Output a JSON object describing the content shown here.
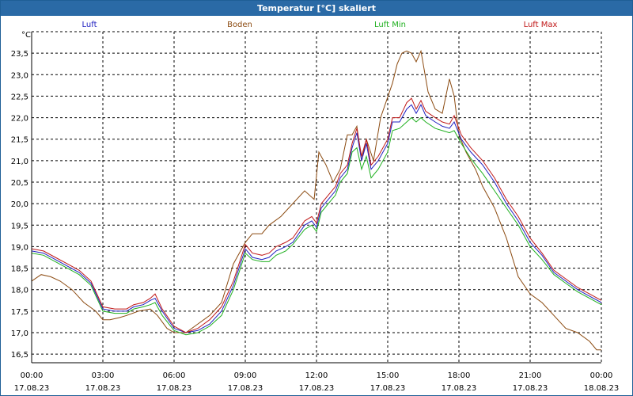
{
  "window": {
    "title": "Temperatur [°C] skaliert"
  },
  "chart_data": {
    "type": "line",
    "title": "Temperatur [°C] skaliert",
    "ylabel": "°C",
    "ylim": [
      16.3,
      24.0
    ],
    "yticks": [
      "16,5",
      "17,0",
      "17,5",
      "18,0",
      "18,5",
      "19,0",
      "19,5",
      "20,0",
      "20,5",
      "21,0",
      "21,5",
      "22,0",
      "22,5",
      "23,0",
      "23,5"
    ],
    "xlim_hours": [
      0,
      24
    ],
    "xticks": [
      {
        "time": "00:00",
        "date": "17.08.23"
      },
      {
        "time": "03:00",
        "date": "17.08.23"
      },
      {
        "time": "06:00",
        "date": "17.08.23"
      },
      {
        "time": "09:00",
        "date": "17.08.23"
      },
      {
        "time": "12:00",
        "date": "17.08.23"
      },
      {
        "time": "15:00",
        "date": "17.08.23"
      },
      {
        "time": "18:00",
        "date": "17.08.23"
      },
      {
        "time": "21:00",
        "date": "17.08.23"
      },
      {
        "time": "00:00",
        "date": "18.08.23"
      }
    ],
    "grid": true,
    "legend_position": "top",
    "series": [
      {
        "name": "Luft",
        "color": "#2020c0",
        "points": [
          [
            0,
            18.9
          ],
          [
            0.5,
            18.85
          ],
          [
            1,
            18.7
          ],
          [
            1.5,
            18.55
          ],
          [
            2,
            18.4
          ],
          [
            2.5,
            18.15
          ],
          [
            3,
            17.55
          ],
          [
            3.5,
            17.5
          ],
          [
            4,
            17.5
          ],
          [
            4.3,
            17.6
          ],
          [
            4.7,
            17.65
          ],
          [
            5,
            17.75
          ],
          [
            5.2,
            17.8
          ],
          [
            5.5,
            17.5
          ],
          [
            6,
            17.1
          ],
          [
            6.5,
            17.0
          ],
          [
            7,
            17.05
          ],
          [
            7.5,
            17.2
          ],
          [
            8,
            17.5
          ],
          [
            8.5,
            18.1
          ],
          [
            9,
            18.95
          ],
          [
            9.3,
            18.75
          ],
          [
            9.7,
            18.7
          ],
          [
            10,
            18.75
          ],
          [
            10.3,
            18.9
          ],
          [
            10.7,
            19.0
          ],
          [
            11,
            19.1
          ],
          [
            11.5,
            19.5
          ],
          [
            11.8,
            19.6
          ],
          [
            12,
            19.45
          ],
          [
            12.2,
            19.9
          ],
          [
            12.5,
            20.1
          ],
          [
            12.8,
            20.3
          ],
          [
            13,
            20.6
          ],
          [
            13.3,
            20.8
          ],
          [
            13.5,
            21.3
          ],
          [
            13.7,
            21.65
          ],
          [
            13.9,
            21.0
          ],
          [
            14.1,
            21.4
          ],
          [
            14.3,
            20.8
          ],
          [
            14.6,
            21.0
          ],
          [
            15,
            21.4
          ],
          [
            15.2,
            21.9
          ],
          [
            15.5,
            21.9
          ],
          [
            15.8,
            22.2
          ],
          [
            16,
            22.3
          ],
          [
            16.2,
            22.1
          ],
          [
            16.4,
            22.3
          ],
          [
            16.6,
            22.05
          ],
          [
            17,
            21.9
          ],
          [
            17.3,
            21.8
          ],
          [
            17.6,
            21.75
          ],
          [
            17.8,
            21.9
          ],
          [
            18.1,
            21.5
          ],
          [
            18.5,
            21.2
          ],
          [
            19,
            20.9
          ],
          [
            19.5,
            20.5
          ],
          [
            20,
            20.0
          ],
          [
            20.5,
            19.6
          ],
          [
            21,
            19.1
          ],
          [
            21.5,
            18.8
          ],
          [
            22,
            18.4
          ],
          [
            22.5,
            18.2
          ],
          [
            23,
            18.0
          ],
          [
            23.5,
            17.85
          ],
          [
            24,
            17.7
          ]
        ]
      },
      {
        "name": "Boden",
        "color": "#8b4a10",
        "points": [
          [
            0,
            18.2
          ],
          [
            0.4,
            18.35
          ],
          [
            0.8,
            18.3
          ],
          [
            1.2,
            18.2
          ],
          [
            1.7,
            18.0
          ],
          [
            2.2,
            17.7
          ],
          [
            2.7,
            17.5
          ],
          [
            3,
            17.3
          ],
          [
            3.3,
            17.3
          ],
          [
            3.7,
            17.35
          ],
          [
            4,
            17.4
          ],
          [
            4.5,
            17.5
          ],
          [
            5,
            17.55
          ],
          [
            5.3,
            17.4
          ],
          [
            5.7,
            17.1
          ],
          [
            6,
            17.0
          ],
          [
            6.5,
            17.0
          ],
          [
            7,
            17.2
          ],
          [
            7.5,
            17.4
          ],
          [
            8,
            17.7
          ],
          [
            8.5,
            18.6
          ],
          [
            9,
            19.1
          ],
          [
            9.3,
            19.3
          ],
          [
            9.7,
            19.3
          ],
          [
            10,
            19.5
          ],
          [
            10.5,
            19.7
          ],
          [
            11,
            20.0
          ],
          [
            11.5,
            20.3
          ],
          [
            11.9,
            20.1
          ],
          [
            12.1,
            21.2
          ],
          [
            12.4,
            20.9
          ],
          [
            12.7,
            20.5
          ],
          [
            13,
            20.8
          ],
          [
            13.3,
            21.6
          ],
          [
            13.5,
            21.6
          ],
          [
            13.7,
            21.8
          ],
          [
            13.9,
            21.0
          ],
          [
            14.1,
            21.5
          ],
          [
            14.4,
            21.0
          ],
          [
            14.7,
            22.0
          ],
          [
            15.2,
            22.8
          ],
          [
            15.4,
            23.25
          ],
          [
            15.6,
            23.5
          ],
          [
            15.8,
            23.55
          ],
          [
            16,
            23.5
          ],
          [
            16.2,
            23.3
          ],
          [
            16.4,
            23.55
          ],
          [
            16.7,
            22.6
          ],
          [
            17,
            22.2
          ],
          [
            17.3,
            22.1
          ],
          [
            17.6,
            22.9
          ],
          [
            17.8,
            22.5
          ],
          [
            18,
            21.6
          ],
          [
            18.3,
            21.2
          ],
          [
            18.7,
            20.8
          ],
          [
            19,
            20.4
          ],
          [
            19.5,
            19.9
          ],
          [
            20,
            19.2
          ],
          [
            20.5,
            18.3
          ],
          [
            21,
            17.9
          ],
          [
            21.5,
            17.7
          ],
          [
            22,
            17.4
          ],
          [
            22.5,
            17.1
          ],
          [
            23,
            17.0
          ],
          [
            23.5,
            16.8
          ],
          [
            23.8,
            16.6
          ],
          [
            24,
            16.6
          ]
        ]
      },
      {
        "name": "Luft Min",
        "color": "#20b020",
        "points": [
          [
            0,
            18.85
          ],
          [
            0.5,
            18.8
          ],
          [
            1,
            18.65
          ],
          [
            1.5,
            18.5
          ],
          [
            2,
            18.35
          ],
          [
            2.5,
            18.1
          ],
          [
            3,
            17.5
          ],
          [
            3.5,
            17.45
          ],
          [
            4,
            17.45
          ],
          [
            4.3,
            17.55
          ],
          [
            4.7,
            17.6
          ],
          [
            5,
            17.65
          ],
          [
            5.2,
            17.7
          ],
          [
            5.5,
            17.4
          ],
          [
            6,
            17.05
          ],
          [
            6.5,
            16.95
          ],
          [
            7,
            17.0
          ],
          [
            7.5,
            17.15
          ],
          [
            8,
            17.4
          ],
          [
            8.5,
            18.0
          ],
          [
            9,
            18.85
          ],
          [
            9.3,
            18.7
          ],
          [
            9.7,
            18.65
          ],
          [
            10,
            18.65
          ],
          [
            10.3,
            18.8
          ],
          [
            10.7,
            18.9
          ],
          [
            11,
            19.05
          ],
          [
            11.5,
            19.4
          ],
          [
            11.8,
            19.5
          ],
          [
            12,
            19.35
          ],
          [
            12.2,
            19.8
          ],
          [
            12.5,
            20.0
          ],
          [
            12.8,
            20.2
          ],
          [
            13,
            20.5
          ],
          [
            13.3,
            20.7
          ],
          [
            13.5,
            21.2
          ],
          [
            13.7,
            21.3
          ],
          [
            13.9,
            20.8
          ],
          [
            14.1,
            21.1
          ],
          [
            14.3,
            20.6
          ],
          [
            14.6,
            20.8
          ],
          [
            15,
            21.2
          ],
          [
            15.2,
            21.7
          ],
          [
            15.5,
            21.75
          ],
          [
            15.8,
            21.9
          ],
          [
            16,
            22.0
          ],
          [
            16.2,
            21.9
          ],
          [
            16.4,
            22.0
          ],
          [
            16.6,
            21.9
          ],
          [
            17,
            21.75
          ],
          [
            17.3,
            21.7
          ],
          [
            17.6,
            21.65
          ],
          [
            17.8,
            21.7
          ],
          [
            18.1,
            21.4
          ],
          [
            18.5,
            21.05
          ],
          [
            19,
            20.7
          ],
          [
            19.5,
            20.3
          ],
          [
            20,
            19.9
          ],
          [
            20.5,
            19.5
          ],
          [
            21,
            19.0
          ],
          [
            21.5,
            18.7
          ],
          [
            22,
            18.35
          ],
          [
            22.5,
            18.15
          ],
          [
            23,
            17.95
          ],
          [
            23.5,
            17.8
          ],
          [
            24,
            17.65
          ]
        ]
      },
      {
        "name": "Luft Max",
        "color": "#c01818",
        "points": [
          [
            0,
            18.95
          ],
          [
            0.5,
            18.9
          ],
          [
            1,
            18.75
          ],
          [
            1.5,
            18.6
          ],
          [
            2,
            18.45
          ],
          [
            2.5,
            18.2
          ],
          [
            3,
            17.6
          ],
          [
            3.5,
            17.55
          ],
          [
            4,
            17.55
          ],
          [
            4.3,
            17.65
          ],
          [
            4.7,
            17.7
          ],
          [
            5,
            17.8
          ],
          [
            5.2,
            17.9
          ],
          [
            5.5,
            17.55
          ],
          [
            6,
            17.15
          ],
          [
            6.5,
            17.0
          ],
          [
            7,
            17.1
          ],
          [
            7.5,
            17.3
          ],
          [
            8,
            17.6
          ],
          [
            8.5,
            18.2
          ],
          [
            9,
            19.05
          ],
          [
            9.3,
            18.85
          ],
          [
            9.7,
            18.8
          ],
          [
            10,
            18.85
          ],
          [
            10.3,
            19.0
          ],
          [
            10.7,
            19.1
          ],
          [
            11,
            19.2
          ],
          [
            11.5,
            19.6
          ],
          [
            11.8,
            19.7
          ],
          [
            12,
            19.55
          ],
          [
            12.2,
            20.0
          ],
          [
            12.5,
            20.2
          ],
          [
            12.8,
            20.4
          ],
          [
            13,
            20.7
          ],
          [
            13.3,
            20.9
          ],
          [
            13.5,
            21.4
          ],
          [
            13.7,
            21.75
          ],
          [
            13.9,
            21.1
          ],
          [
            14.1,
            21.5
          ],
          [
            14.3,
            20.9
          ],
          [
            14.6,
            21.1
          ],
          [
            15,
            21.5
          ],
          [
            15.2,
            22.0
          ],
          [
            15.5,
            22.0
          ],
          [
            15.8,
            22.35
          ],
          [
            16,
            22.45
          ],
          [
            16.2,
            22.2
          ],
          [
            16.4,
            22.4
          ],
          [
            16.6,
            22.15
          ],
          [
            17,
            22.0
          ],
          [
            17.3,
            21.9
          ],
          [
            17.6,
            21.85
          ],
          [
            17.8,
            22.05
          ],
          [
            18.1,
            21.6
          ],
          [
            18.5,
            21.3
          ],
          [
            19,
            21.0
          ],
          [
            19.5,
            20.6
          ],
          [
            20,
            20.1
          ],
          [
            20.5,
            19.7
          ],
          [
            21,
            19.2
          ],
          [
            21.5,
            18.85
          ],
          [
            22,
            18.45
          ],
          [
            22.5,
            18.25
          ],
          [
            23,
            18.05
          ],
          [
            23.5,
            17.9
          ],
          [
            24,
            17.75
          ]
        ]
      }
    ]
  }
}
